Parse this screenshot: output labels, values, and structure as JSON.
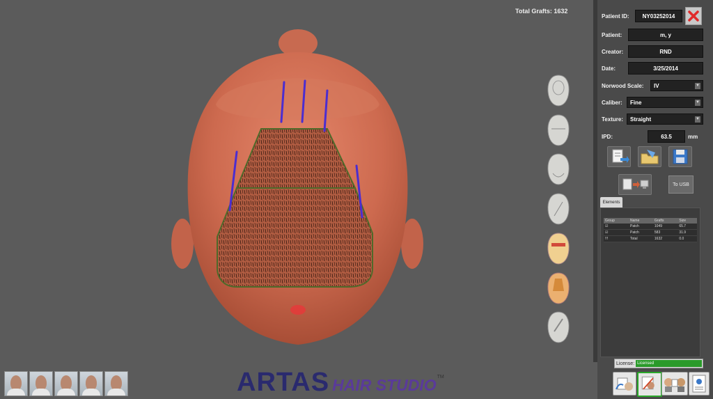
{
  "viewport": {
    "total_grafts": "Total Grafts: 1632"
  },
  "patient": {
    "id_label": "Patient ID:",
    "id_value": "NY03252014",
    "patient_label": "Patient:",
    "patient_value": "m, y",
    "creator_label": "Creator:",
    "creator_value": "RND",
    "date_label": "Date:",
    "date_value": "3/25/2014",
    "norwood_label": "Norwood Scale:",
    "norwood_value": "IV",
    "caliber_label": "Caliber:",
    "caliber_value": "Fine",
    "texture_label": "Texture:",
    "texture_value": "Straight",
    "ipd_label": "IPD:",
    "ipd_value": "63.5",
    "ipd_unit": "mm"
  },
  "tools": {
    "usb_label": "To USB"
  },
  "elements": {
    "tab_label": "Elements",
    "columns": [
      "Group",
      "Name",
      "Grafts",
      "Size"
    ],
    "rows": [
      {
        "group": "☑",
        "name": "Patch",
        "grafts": "1049",
        "size": "65.7"
      },
      {
        "group": "☑",
        "name": "Patch",
        "grafts": "583",
        "size": "31.9"
      },
      {
        "group": "!!!",
        "name": "Total",
        "grafts": "1632",
        "size": "0.0"
      }
    ]
  },
  "license": {
    "label": "License:",
    "value": "Licensed"
  },
  "logo": {
    "artas": "ARTAS",
    "hair_studio": "HAIR STUDIO",
    "tm": "TM"
  },
  "colors": {
    "accent_green": "#2a9a2a",
    "grafts_purple": "#4b2dd0",
    "zone_outline": "#4f6a2a",
    "skin": "#d06a4e"
  },
  "icons": {
    "close": "close-x-icon",
    "views": [
      "head-top-view-icon",
      "head-front-view-icon",
      "head-back-view-icon",
      "head-left-view-icon",
      "head-zones-view-icon",
      "head-density-view-icon",
      "head-right-view-icon"
    ],
    "tools": [
      "export-document-icon",
      "import-folder-icon",
      "save-disk-icon",
      "photo-transfer-icon"
    ],
    "nav": [
      "patient-photos-nav-icon",
      "plan-design-nav-icon",
      "consult-nav-icon",
      "report-nav-icon"
    ]
  }
}
